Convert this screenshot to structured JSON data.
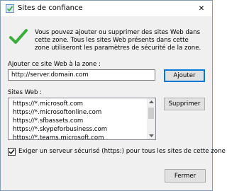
{
  "window": {
    "title": "Sites de confiance",
    "close_glyph": "✕"
  },
  "intro_text": "Vous pouvez ajouter ou supprimer des sites Web dans cette zone. Tous les sites Web présents dans cette zone utiliseront les paramètres de sécurité de la zone.",
  "add": {
    "label": "Ajouter ce site Web à la zone :",
    "input_value": "http://server.domain.com",
    "button_label": "Ajouter"
  },
  "sites": {
    "label": "Sites Web :",
    "items": [
      "https://*.microsoft.com",
      "https://*.microsoftonline.com",
      "https://*.sfbassets.com",
      "https://*.skypeforbusiness.com",
      "https://*.teams.microsoft.com"
    ],
    "remove_button_label": "Supprimer"
  },
  "require_https": {
    "checked": true,
    "label": "Exiger un serveur sécurisé (https:) pour tous les sites de cette zone"
  },
  "close_button_label": "Fermer",
  "colors": {
    "accent": "#0078d7",
    "check_green": "#3cae3c"
  }
}
